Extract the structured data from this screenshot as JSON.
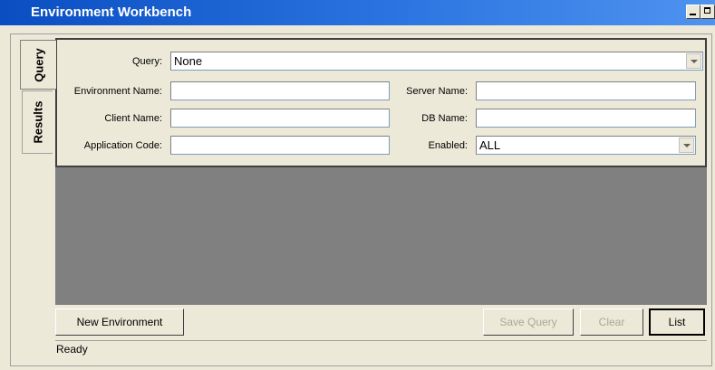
{
  "window": {
    "title": "Environment Workbench"
  },
  "tabs": {
    "query": "Query",
    "results": "Results"
  },
  "form": {
    "query_label": "Query:",
    "query_value": "None",
    "environment_name_label": "Environment Name:",
    "environment_name_value": "",
    "server_name_label": "Server Name:",
    "server_name_value": "",
    "client_name_label": "Client Name:",
    "client_name_value": "",
    "db_name_label": "DB Name:",
    "db_name_value": "",
    "application_code_label": "Application Code:",
    "application_code_value": "",
    "enabled_label": "Enabled:",
    "enabled_value": "ALL"
  },
  "buttons": {
    "new_environment": "New Environment",
    "save_query": "Save Query",
    "clear": "Clear",
    "list": "List"
  },
  "status": {
    "text": "Ready"
  },
  "colors": {
    "title_bar": "#0a4ec2",
    "results_area": "#808080",
    "window_bg": "#ece9d8"
  }
}
